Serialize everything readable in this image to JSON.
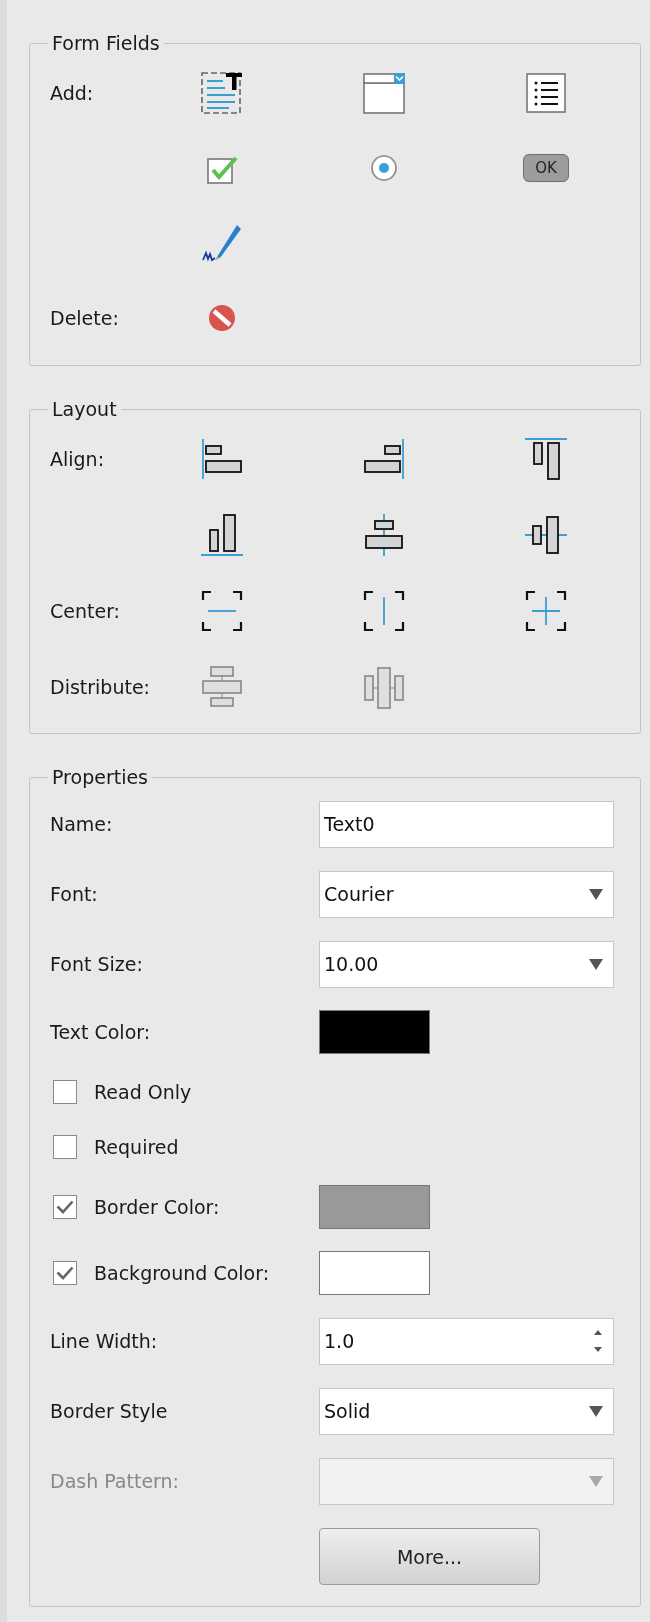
{
  "form_fields": {
    "title": "Form Fields",
    "add_label": "Add:",
    "add_tools": [
      {
        "kind": "text-field"
      },
      {
        "kind": "combo-box"
      },
      {
        "kind": "list-box"
      },
      {
        "kind": "checkbox"
      },
      {
        "kind": "radio-button"
      },
      {
        "kind": "push-button",
        "label": "OK"
      },
      {
        "kind": "signature"
      }
    ],
    "delete_label": "Delete:",
    "delete_tool": {
      "kind": "delete"
    }
  },
  "layout": {
    "title": "Layout",
    "rows": [
      {
        "label": "Align:",
        "tools": [
          {
            "kind": "align-left",
            "disabled": false
          },
          {
            "kind": "align-right",
            "disabled": false
          },
          {
            "kind": "align-top",
            "disabled": false
          }
        ]
      },
      {
        "tools": [
          {
            "kind": "align-bottom",
            "disabled": false
          },
          {
            "kind": "align-center",
            "disabled": false
          },
          {
            "kind": "align-middle",
            "disabled": false
          }
        ]
      },
      {
        "label": "Center:",
        "tools": [
          {
            "kind": "center-horizontal",
            "disabled": false
          },
          {
            "kind": "center-vertical",
            "disabled": false
          },
          {
            "kind": "center-both",
            "disabled": false
          }
        ]
      },
      {
        "label": "Distribute:",
        "tools": [
          {
            "kind": "distribute-vertical",
            "disabled": true
          },
          {
            "kind": "distribute-horizontal",
            "disabled": true
          }
        ]
      }
    ]
  },
  "properties": {
    "title": "Properties",
    "fields": [
      {
        "kind": "text",
        "label": "Name:",
        "value": "Text0",
        "disabled": false
      },
      {
        "kind": "select",
        "label": "Font:",
        "value": "Courier",
        "disabled": false
      },
      {
        "kind": "select",
        "label": "Font Size:",
        "value": "10.00",
        "disabled": false
      },
      {
        "kind": "color",
        "label": "Text Color:",
        "color": "#000000",
        "disabled": false
      },
      {
        "kind": "checkbox",
        "label": "Read Only",
        "checked": false,
        "disabled": false
      },
      {
        "kind": "checkbox",
        "label": "Required",
        "checked": false,
        "disabled": false
      },
      {
        "kind": "checkbox-color",
        "label": "Border Color:",
        "checked": true,
        "color": "#999999",
        "disabled": false
      },
      {
        "kind": "checkbox-color",
        "label": "Background Color:",
        "checked": true,
        "color": "#ffffff",
        "disabled": false
      },
      {
        "kind": "spin",
        "label": "Line Width:",
        "value": "1.0",
        "disabled": false
      },
      {
        "kind": "select",
        "label": "Border Style",
        "value": "Solid",
        "disabled": false
      },
      {
        "kind": "select",
        "label": "Dash Pattern:",
        "disabled": true
      }
    ],
    "more_button": "More..."
  }
}
